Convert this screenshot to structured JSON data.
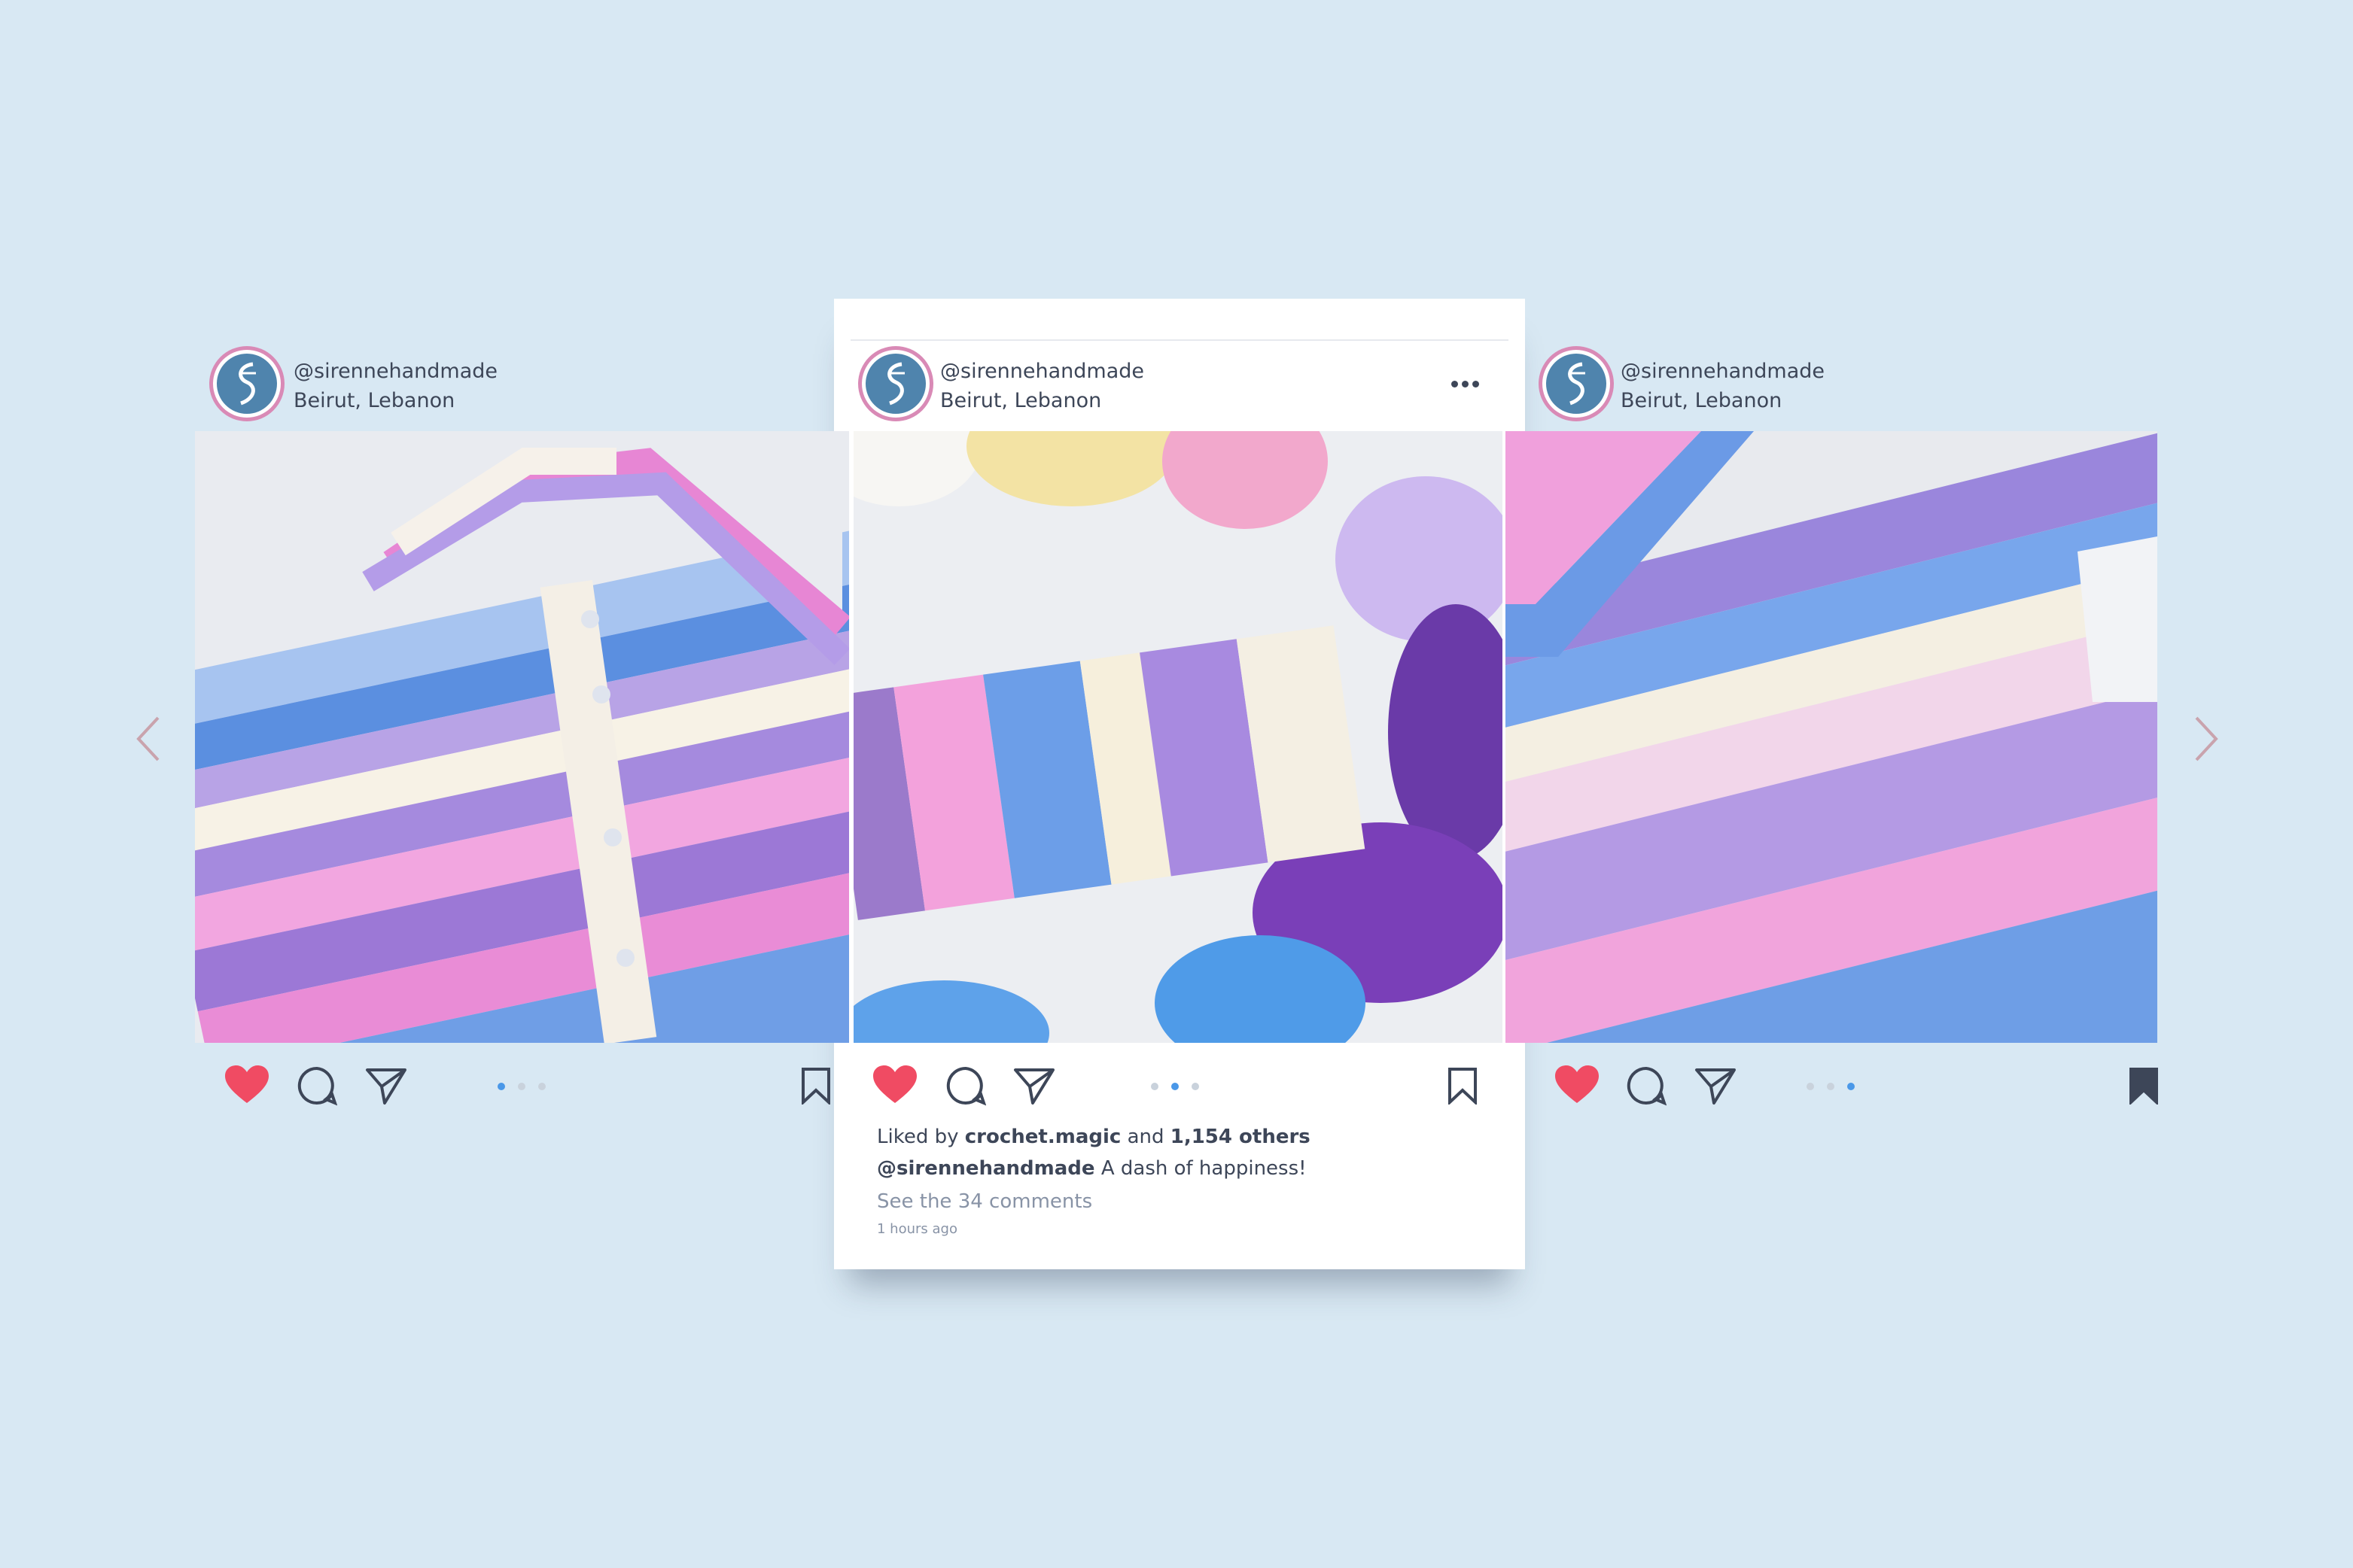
{
  "carousel": {
    "prev_arrow": "chevron-left-icon",
    "next_arrow": "chevron-right-icon",
    "posts": [
      {
        "username": "@sirennehandmade",
        "location": "Beirut, Lebanon",
        "active_dot": 0,
        "saved": false,
        "liked": true
      },
      {
        "username": "@sirennehandmade",
        "location": "Beirut, Lebanon",
        "active_dot": 1,
        "saved": false,
        "liked": true,
        "likes_prefix": "Liked by",
        "liked_by_user": "crochet.magic",
        "likes_and": "and",
        "likes_count": "1,154 others",
        "caption_user": "@sirennehandmade",
        "caption_text": "A dash of happiness!",
        "comments_link": "See the 34 comments",
        "time_ago": "1 hours ago"
      },
      {
        "username": "@sirennehandmade",
        "location": "Beirut, Lebanon",
        "active_dot": 2,
        "saved": true,
        "liked": true
      }
    ]
  },
  "colors": {
    "background": "#d8e8f3",
    "heart": "#f04b63",
    "dot_active": "#4a98e8",
    "text": "#3d4658",
    "muted": "#8893a6",
    "avatar": "#4f84ad",
    "avatar_ring": "#d98ab6",
    "arrow": "#c9a3ad"
  }
}
